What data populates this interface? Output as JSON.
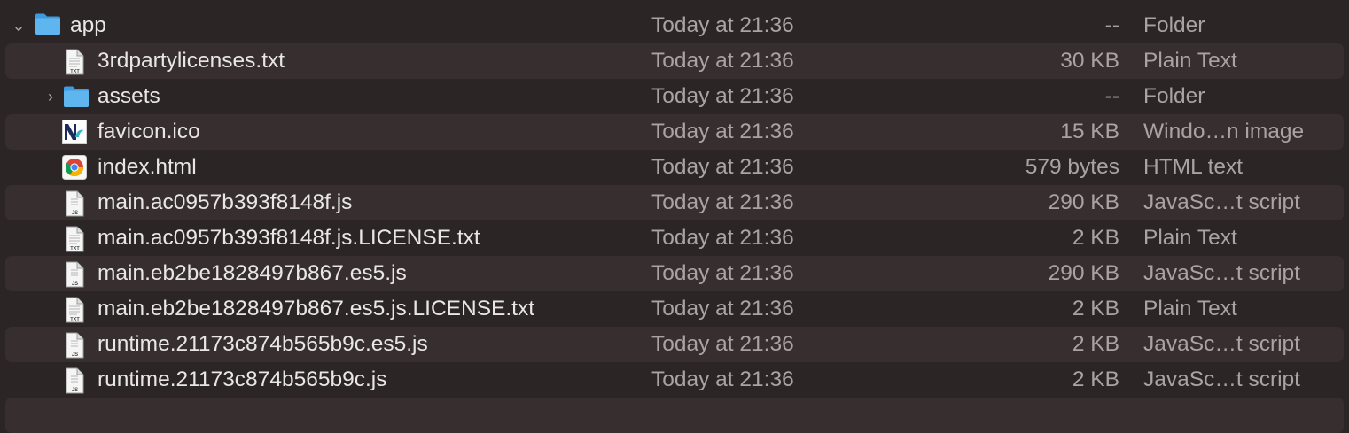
{
  "rows": [
    {
      "name": "app",
      "date": "Today at 21:36",
      "size": "--",
      "kind": "Folder",
      "icon": "folder-icon",
      "level": 0,
      "disclosure": "expanded"
    },
    {
      "name": "3rdpartylicenses.txt",
      "date": "Today at 21:36",
      "size": "30 KB",
      "kind": "Plain Text",
      "icon": "txt-file-icon",
      "badge": "TXT",
      "level": 1
    },
    {
      "name": "assets",
      "date": "Today at 21:36",
      "size": "--",
      "kind": "Folder",
      "icon": "folder-icon",
      "level": 1,
      "disclosure": "collapsed"
    },
    {
      "name": "favicon.ico",
      "date": "Today at 21:36",
      "size": "15 KB",
      "kind": "Windo…n image",
      "icon": "favicon-icon",
      "level": 1
    },
    {
      "name": "index.html",
      "date": "Today at 21:36",
      "size": "579 bytes",
      "kind": "HTML text",
      "icon": "chrome-icon",
      "level": 1
    },
    {
      "name": "main.ac0957b393f8148f.js",
      "date": "Today at 21:36",
      "size": "290 KB",
      "kind": "JavaSc…t script",
      "icon": "js-file-icon",
      "badge": "JS",
      "level": 1
    },
    {
      "name": "main.ac0957b393f8148f.js.LICENSE.txt",
      "date": "Today at 21:36",
      "size": "2 KB",
      "kind": "Plain Text",
      "icon": "txt-file-icon",
      "badge": "TXT",
      "level": 1
    },
    {
      "name": "main.eb2be1828497b867.es5.js",
      "date": "Today at 21:36",
      "size": "290 KB",
      "kind": "JavaSc…t script",
      "icon": "js-file-icon",
      "badge": "JS",
      "level": 1
    },
    {
      "name": "main.eb2be1828497b867.es5.js.LICENSE.txt",
      "date": "Today at 21:36",
      "size": "2 KB",
      "kind": "Plain Text",
      "icon": "txt-file-icon",
      "badge": "TXT",
      "level": 1
    },
    {
      "name": "runtime.21173c874b565b9c.es5.js",
      "date": "Today at 21:36",
      "size": "2 KB",
      "kind": "JavaSc…t script",
      "icon": "js-file-icon",
      "badge": "JS",
      "level": 1
    },
    {
      "name": "runtime.21173c874b565b9c.js",
      "date": "Today at 21:36",
      "size": "2 KB",
      "kind": "JavaSc…t script",
      "icon": "js-file-icon",
      "badge": "JS",
      "level": 1
    },
    {
      "name": "",
      "date": "",
      "size": "",
      "kind": "",
      "icon": "",
      "level": 1
    }
  ],
  "glyphs": {
    "expanded": "⌄",
    "collapsed": "›"
  },
  "colors": {
    "background": "#2c2525",
    "stripe": "#372f2f",
    "folder": "#5fb6ee",
    "text": "#e8e6e6",
    "secondary": "#a9a3a3"
  }
}
